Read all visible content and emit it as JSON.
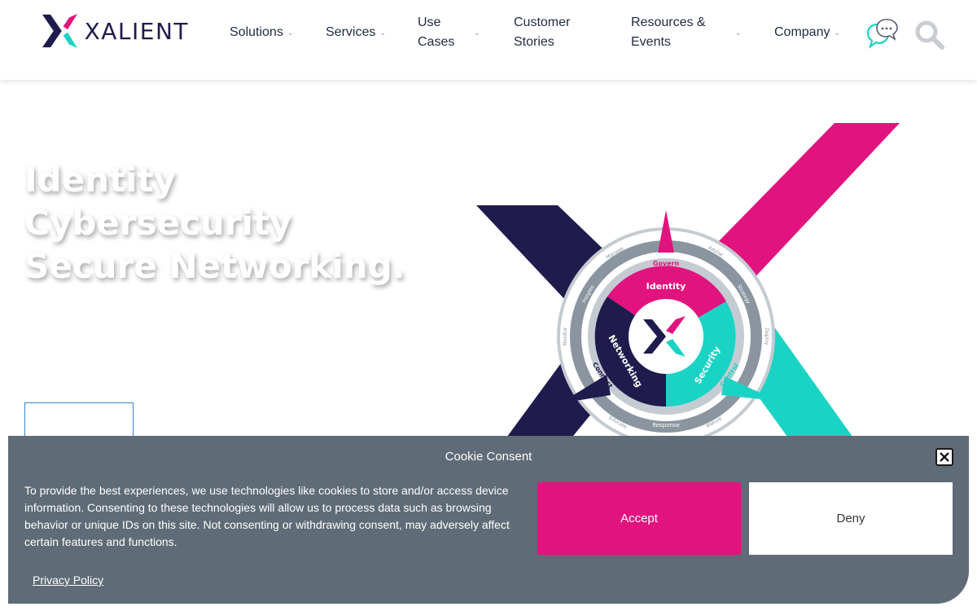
{
  "brand": {
    "name": "XALIENT",
    "colors": {
      "navy": "#1f1b4d",
      "pink": "#e1137f",
      "teal": "#19d3c5",
      "gray": "#8a95a0"
    }
  },
  "nav": {
    "items": [
      {
        "label": "Solutions"
      },
      {
        "label": "Services"
      },
      {
        "label_line1": "Use",
        "label_line2": "Cases"
      },
      {
        "label_line1": "Customer",
        "label_line2": "Stories"
      },
      {
        "label_line1": "Resources &",
        "label_line2": "Events"
      },
      {
        "label": "Company"
      }
    ],
    "chevron": "⌄",
    "chat_icon": "chat-bubbles-icon",
    "search_icon": "search-icon"
  },
  "hero": {
    "lines": [
      "Identity",
      "Cybersecurity",
      "Secure Networking."
    ]
  },
  "wheel": {
    "center_segments": [
      "Identity",
      "Security",
      "Networking"
    ],
    "ring_labels": [
      "Govern",
      "Control",
      "Connect"
    ],
    "outer_labels": [
      "Manage",
      "Advise",
      "Strategy",
      "Deploy",
      "Mature",
      "Response",
      "Educate",
      "Monitor",
      "Insights"
    ]
  },
  "cookie": {
    "title": "Cookie Consent",
    "text": "To provide the best experiences, we use technologies like cookies to store and/or access device information. Consenting to these technologies will allow us to process data such as browsing behavior or unique IDs on this site. Not consenting or withdrawing consent, may adversely affect certain features and functions.",
    "accept": "Accept",
    "deny": "Deny",
    "privacy": "Privacy Policy"
  }
}
